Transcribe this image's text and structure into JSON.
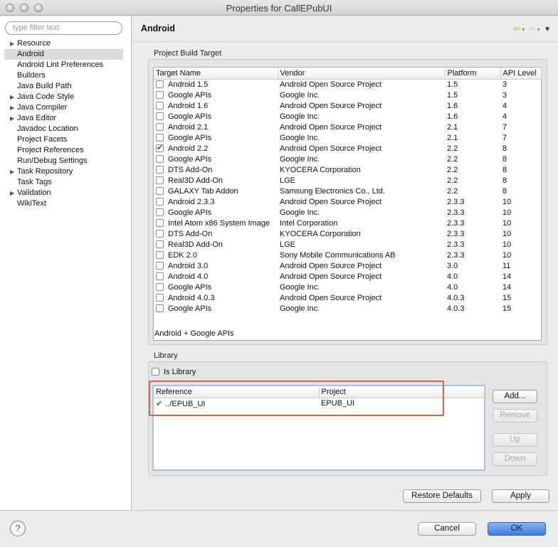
{
  "window": {
    "title": "Properties for CallEPubUI"
  },
  "filter": {
    "placeholder": "type filter text"
  },
  "sidebar": {
    "items": [
      {
        "label": "Resource",
        "expandable": true
      },
      {
        "label": "Android",
        "selected": true
      },
      {
        "label": "Android Lint Preferences"
      },
      {
        "label": "Builders"
      },
      {
        "label": "Java Build Path"
      },
      {
        "label": "Java Code Style",
        "expandable": true
      },
      {
        "label": "Java Compiler",
        "expandable": true
      },
      {
        "label": "Java Editor",
        "expandable": true
      },
      {
        "label": "Javadoc Location"
      },
      {
        "label": "Project Facets"
      },
      {
        "label": "Project References"
      },
      {
        "label": "Run/Debug Settings"
      },
      {
        "label": "Task Repository",
        "expandable": true
      },
      {
        "label": "Task Tags"
      },
      {
        "label": "Validation",
        "expandable": true
      },
      {
        "label": "WikiText"
      }
    ]
  },
  "page": {
    "title": "Android"
  },
  "build_target": {
    "group_label": "Project Build Target",
    "columns": [
      "Target Name",
      "Vendor",
      "Platform",
      "API Level"
    ],
    "rows": [
      {
        "name": "Android 1.5",
        "vendor": "Android Open Source Project",
        "platform": "1.5",
        "api": "3",
        "checked": false
      },
      {
        "name": "Google APIs",
        "vendor": "Google Inc.",
        "platform": "1.5",
        "api": "3",
        "checked": false
      },
      {
        "name": "Android 1.6",
        "vendor": "Android Open Source Project",
        "platform": "1.6",
        "api": "4",
        "checked": false
      },
      {
        "name": "Google APIs",
        "vendor": "Google Inc.",
        "platform": "1.6",
        "api": "4",
        "checked": false
      },
      {
        "name": "Android 2.1",
        "vendor": "Android Open Source Project",
        "platform": "2.1",
        "api": "7",
        "checked": false
      },
      {
        "name": "Google APIs",
        "vendor": "Google Inc.",
        "platform": "2.1",
        "api": "7",
        "checked": false
      },
      {
        "name": "Android 2.2",
        "vendor": "Android Open Source Project",
        "platform": "2.2",
        "api": "8",
        "checked": true
      },
      {
        "name": "Google APIs",
        "vendor": "Google Inc.",
        "platform": "2.2",
        "api": "8",
        "checked": false
      },
      {
        "name": "DTS Add-On",
        "vendor": "KYOCERA Corporation",
        "platform": "2.2",
        "api": "8",
        "checked": false
      },
      {
        "name": "Real3D Add-On",
        "vendor": "LGE",
        "platform": "2.2",
        "api": "8",
        "checked": false
      },
      {
        "name": "GALAXY Tab Addon",
        "vendor": "Samsung Electronics Co., Ltd.",
        "platform": "2.2",
        "api": "8",
        "checked": false
      },
      {
        "name": "Android 2.3.3",
        "vendor": "Android Open Source Project",
        "platform": "2.3.3",
        "api": "10",
        "checked": false
      },
      {
        "name": "Google APIs",
        "vendor": "Google Inc.",
        "platform": "2.3.3",
        "api": "10",
        "checked": false
      },
      {
        "name": "Intel Atom x86 System Image",
        "vendor": "Intel Corporation",
        "platform": "2.3.3",
        "api": "10",
        "checked": false
      },
      {
        "name": "DTS Add-On",
        "vendor": "KYOCERA Corporation",
        "platform": "2.3.3",
        "api": "10",
        "checked": false
      },
      {
        "name": "Real3D Add-On",
        "vendor": "LGE",
        "platform": "2.3.3",
        "api": "10",
        "checked": false
      },
      {
        "name": "EDK 2.0",
        "vendor": "Sony Mobile Communications AB",
        "platform": "2.3.3",
        "api": "10",
        "checked": false
      },
      {
        "name": "Android 3.0",
        "vendor": "Android Open Source Project",
        "platform": "3.0",
        "api": "11",
        "checked": false
      },
      {
        "name": "Android 4.0",
        "vendor": "Android Open Source Project",
        "platform": "4.0",
        "api": "14",
        "checked": false
      },
      {
        "name": "Google APIs",
        "vendor": "Google Inc.",
        "platform": "4.0",
        "api": "14",
        "checked": false
      },
      {
        "name": "Android 4.0.3",
        "vendor": "Android Open Source Project",
        "platform": "4.0.3",
        "api": "15",
        "checked": false
      },
      {
        "name": "Google APIs",
        "vendor": "Google Inc.",
        "platform": "4.0.3",
        "api": "15",
        "checked": false
      }
    ],
    "status": "Android + Google APIs"
  },
  "library": {
    "group_label": "Library",
    "is_library_label": "Is Library",
    "is_library_checked": false,
    "columns": [
      "Reference",
      "Project"
    ],
    "rows": [
      {
        "reference": "../EPUB_UI",
        "project": "EPUB_UI",
        "status_icon": "checkmark-icon"
      }
    ],
    "buttons": {
      "add": "Add...",
      "remove": "Remove",
      "up": "Up",
      "down": "Down"
    }
  },
  "actions": {
    "restore_defaults": "Restore Defaults",
    "apply": "Apply",
    "cancel": "Cancel",
    "ok": "OK"
  },
  "colors": {
    "highlight_box": "#d9604a",
    "ok_button": "#3d7ce0",
    "checkmark": "#3aa83a"
  }
}
